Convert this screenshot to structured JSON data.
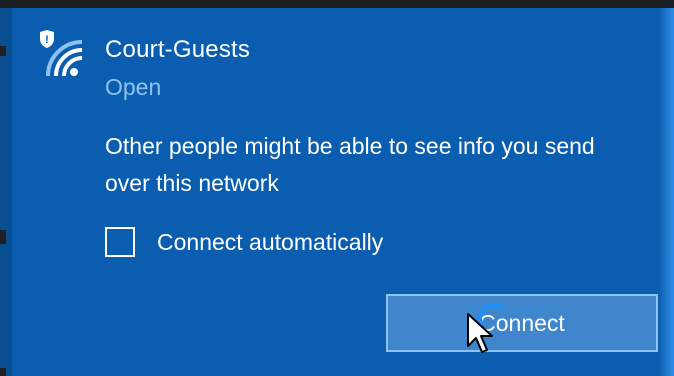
{
  "network": {
    "name": "Court-Guests",
    "status": "Open",
    "warning": "Other people might be able to see info you send over this network",
    "connect_automatically_label": "Connect automatically",
    "connect_automatically_checked": false,
    "connect_button_label": "Connect"
  },
  "icons": {
    "wifi": "wifi-shield-icon",
    "busy": "busy-spinner-icon",
    "cursor": "mouse-cursor-icon"
  },
  "colors": {
    "panel_background": "#0b5eaf",
    "secondary_text": "#8fc1ee",
    "button_background": "#3f86cc",
    "button_border": "#8ec3f0"
  }
}
